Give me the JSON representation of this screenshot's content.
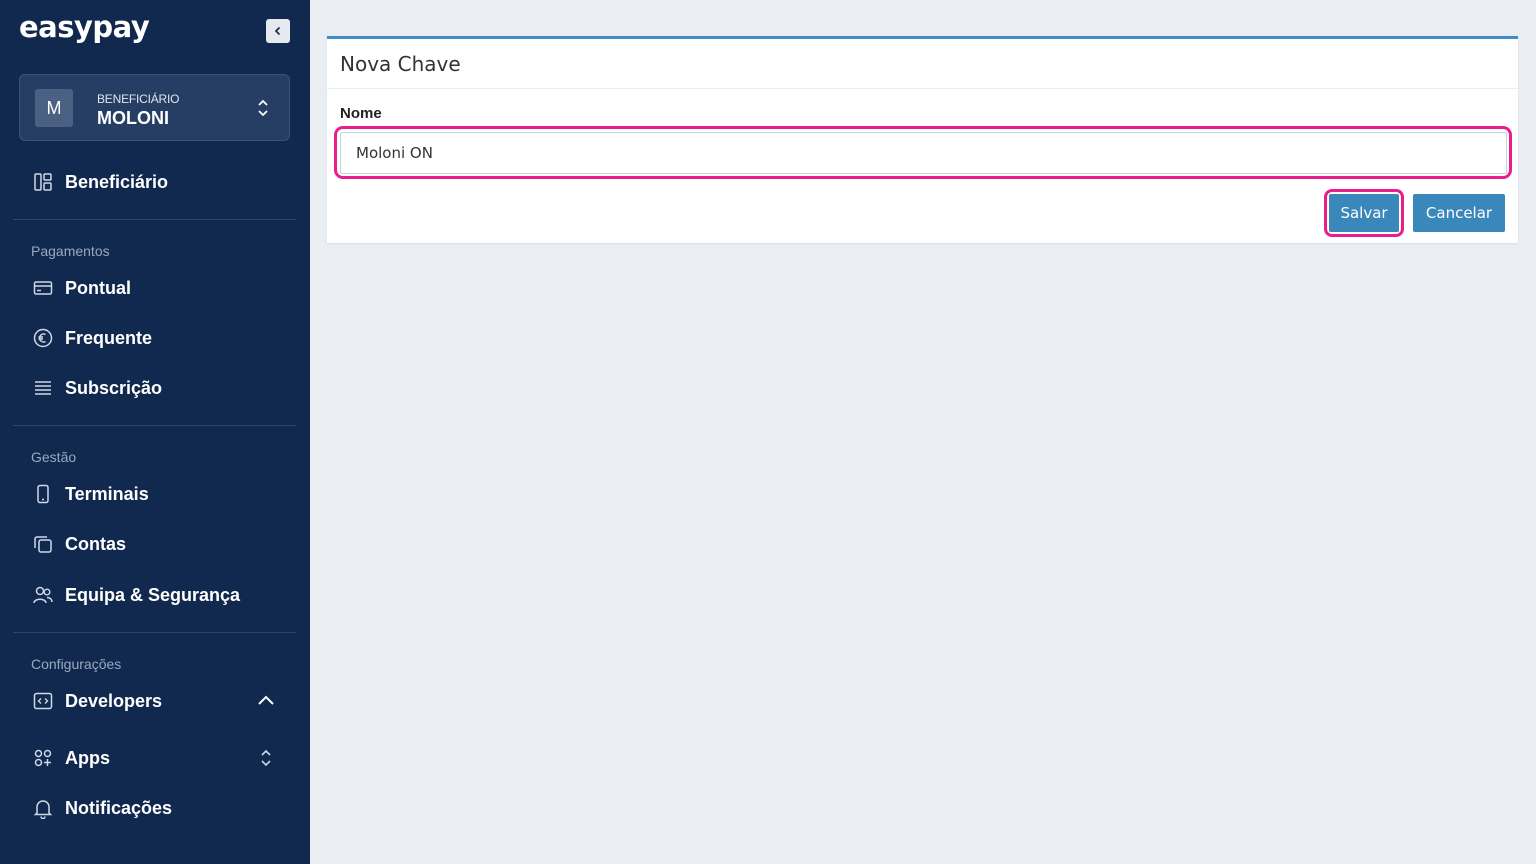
{
  "brand": {
    "logo_text": "easypay"
  },
  "account": {
    "initial": "M",
    "role": "BENEFICIÁRIO",
    "name": "MOLONI"
  },
  "sidebar": {
    "top_item": {
      "label": "Beneficiário",
      "icon": "dashboard-icon"
    },
    "sections": [
      {
        "title": "Pagamentos",
        "items": [
          {
            "label": "Pontual",
            "icon": "card-icon"
          },
          {
            "label": "Frequente",
            "icon": "euro-icon"
          },
          {
            "label": "Subscrição",
            "icon": "list-icon"
          }
        ]
      },
      {
        "title": "Gestão",
        "items": [
          {
            "label": "Terminais",
            "icon": "phone-icon"
          },
          {
            "label": "Contas",
            "icon": "copy-icon"
          },
          {
            "label": "Equipa & Segurança",
            "icon": "users-icon"
          }
        ]
      },
      {
        "title": "Configurações",
        "items": [
          {
            "label": "Developers",
            "icon": "code-icon",
            "expanded": true
          },
          {
            "label": "Apps",
            "icon": "apps-icon"
          },
          {
            "label": "Notificações",
            "icon": "bell-icon"
          }
        ]
      }
    ]
  },
  "form": {
    "title": "Nova Chave",
    "name_label": "Nome",
    "name_value": "Moloni ON",
    "save_label": "Salvar",
    "cancel_label": "Cancelar"
  },
  "colors": {
    "sidebar_bg": "#11294f",
    "accent": "#3a87bc",
    "highlight": "#e91e8c",
    "page_bg": "#eaeef3"
  }
}
